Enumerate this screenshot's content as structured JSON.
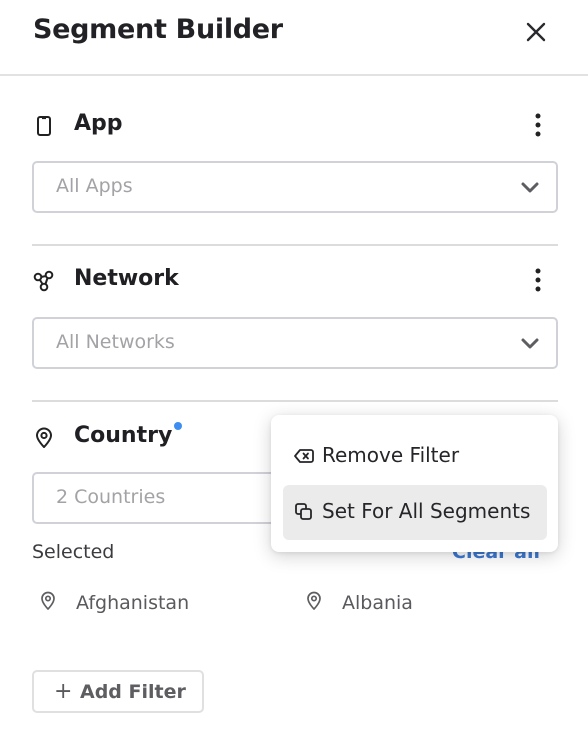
{
  "header": {
    "title": "Segment Builder",
    "close_icon": "close-icon"
  },
  "sections": [
    {
      "icon": "mobile-phone-icon",
      "label": "App",
      "select_placeholder": "All Apps",
      "has_badge": false
    },
    {
      "icon": "network-nodes-icon",
      "label": "Network",
      "select_placeholder": "All Networks",
      "has_badge": false
    },
    {
      "icon": "location-pin-icon",
      "label": "Country",
      "select_value": "2 Countries",
      "has_badge": true,
      "badge_color": "#3d8ef0"
    }
  ],
  "country_selection": {
    "selected_label": "Selected",
    "clear_all_label": "Clear all",
    "items": [
      {
        "icon": "location-pin-icon",
        "label": "Afghanistan"
      },
      {
        "icon": "location-pin-icon",
        "label": "Albania"
      }
    ]
  },
  "add_filter": {
    "icon": "plus-icon",
    "label": "Add Filter"
  },
  "context_menu": {
    "items": [
      {
        "icon": "backspace-x-icon",
        "label": "Remove Filter",
        "highlighted": false
      },
      {
        "icon": "copy-icon",
        "label": "Set For All Segments",
        "highlighted": true
      }
    ]
  },
  "colors": {
    "accent": "#3b78d0",
    "badge": "#3d8ef0",
    "menu_highlight": "#ebebeb"
  }
}
